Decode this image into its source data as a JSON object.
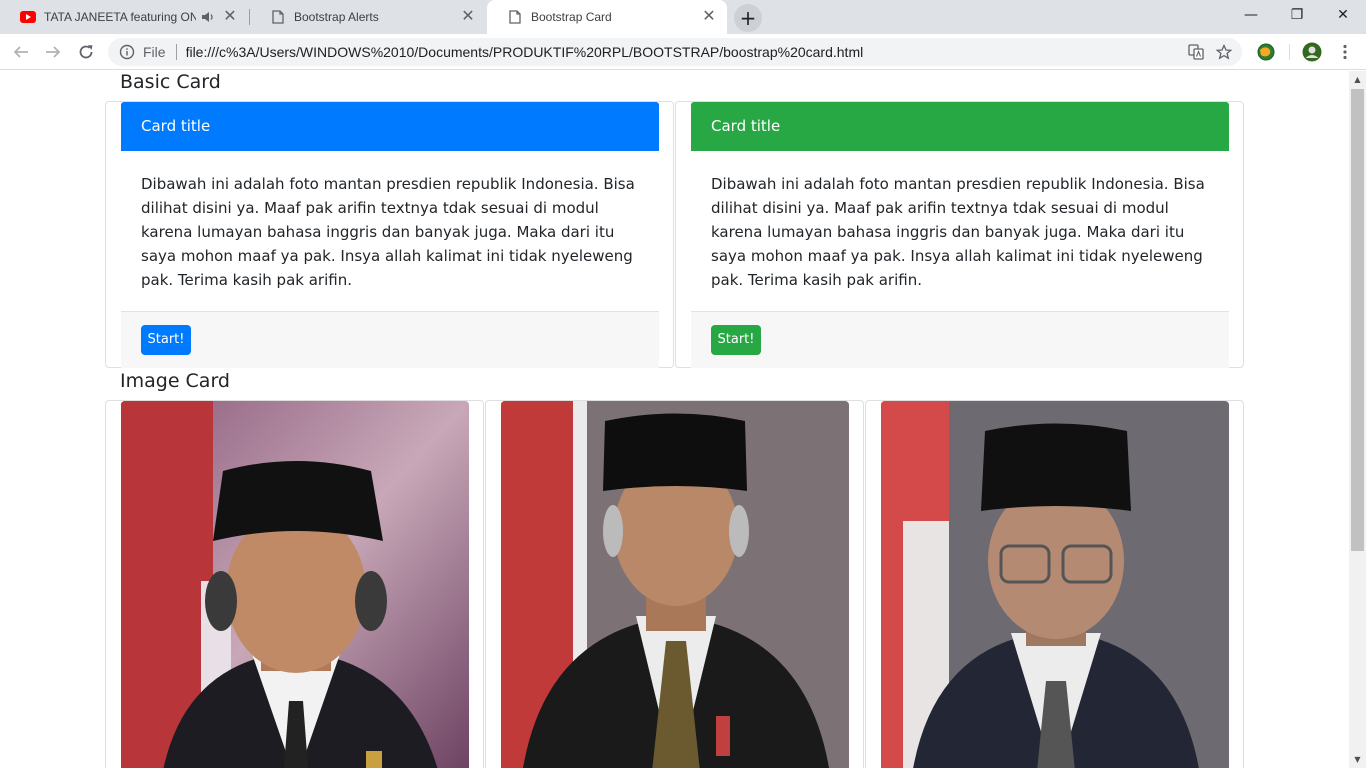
{
  "browser": {
    "tabs": [
      {
        "title": "TATA JANEETA featuring ONC",
        "icon": "youtube-icon",
        "audio": true
      },
      {
        "title": "Bootstrap Alerts",
        "icon": "page-icon"
      },
      {
        "title": "Bootstrap Card",
        "icon": "page-icon",
        "active": true
      }
    ],
    "close_glyph": "✕",
    "new_tab_glyph": "+",
    "window": {
      "minimize": "—",
      "restore": "❐",
      "close": "✕"
    },
    "address": {
      "scheme": "File",
      "url": "file:///c%3A/Users/WINDOWS%2010/Documents/PRODUKTIF%20RPL/BOOTSTRAP/boostrap%20card.html"
    }
  },
  "page": {
    "basic_title": "Basic Card",
    "image_title": "Image Card",
    "cards": [
      {
        "header": "Card title",
        "header_color": "#007bff",
        "body": "Dibawah ini adalah foto mantan presdien republik Indonesia. Bisa dilihat disini ya. Maaf pak arifin textnya tdak sesuai di modul karena lumayan bahasa inggris dan banyak juga. Maka dari itu saya mohon maaf ya pak. Insya allah kalimat ini tidak nyeleweng pak. Terima kasih pak arifin.",
        "button": "Start!",
        "button_color": "#007bff"
      },
      {
        "header": "Card title",
        "header_color": "#28a745",
        "body": "Dibawah ini adalah foto mantan presdien republik Indonesia. Bisa dilihat disini ya. Maaf pak arifin textnya tdak sesuai di modul karena lumayan bahasa inggris dan banyak juga. Maka dari itu saya mohon maaf ya pak. Insya allah kalimat ini tidak nyeleweng pak. Terima kasih pak arifin.",
        "button": "Start!",
        "button_color": "#28a745"
      }
    ],
    "images": [
      {
        "name": "portrait-photo-1"
      },
      {
        "name": "portrait-photo-2"
      },
      {
        "name": "portrait-photo-3"
      }
    ]
  }
}
